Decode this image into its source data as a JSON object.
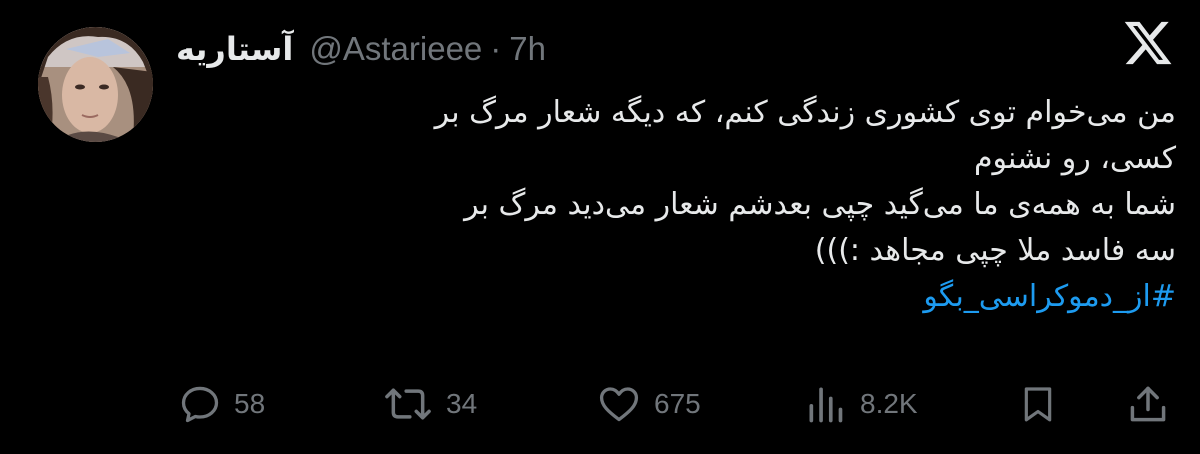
{
  "author": {
    "display_name": "آستاریه",
    "handle": "@Astarieee",
    "separator": "·",
    "time": "7h"
  },
  "tweet": {
    "lines": [
      "من می‌خوام توی کشوری زندگی کنم، که دیگه شعار مرگ بر",
      "کسی، رو نشنوم",
      "شما به همه‌ی ما می‌گید چپی بعدشم شعار می‌دید مرگ بر",
      "سه فاسد ملا چپی مجاهد :)))"
    ],
    "hashtag": "#از_دموکراسی_بگو"
  },
  "actions": {
    "replies": "58",
    "reposts": "34",
    "likes": "675",
    "views": "8.2K"
  },
  "icons": {
    "logo": "x-logo-icon",
    "reply": "reply-icon",
    "repost": "repost-icon",
    "like": "heart-icon",
    "views": "views-icon",
    "bookmark": "bookmark-icon",
    "share": "share-icon"
  },
  "colors": {
    "background": "#000000",
    "text": "#e7e9ea",
    "secondary": "#71767b",
    "link": "#1d9bf0"
  }
}
